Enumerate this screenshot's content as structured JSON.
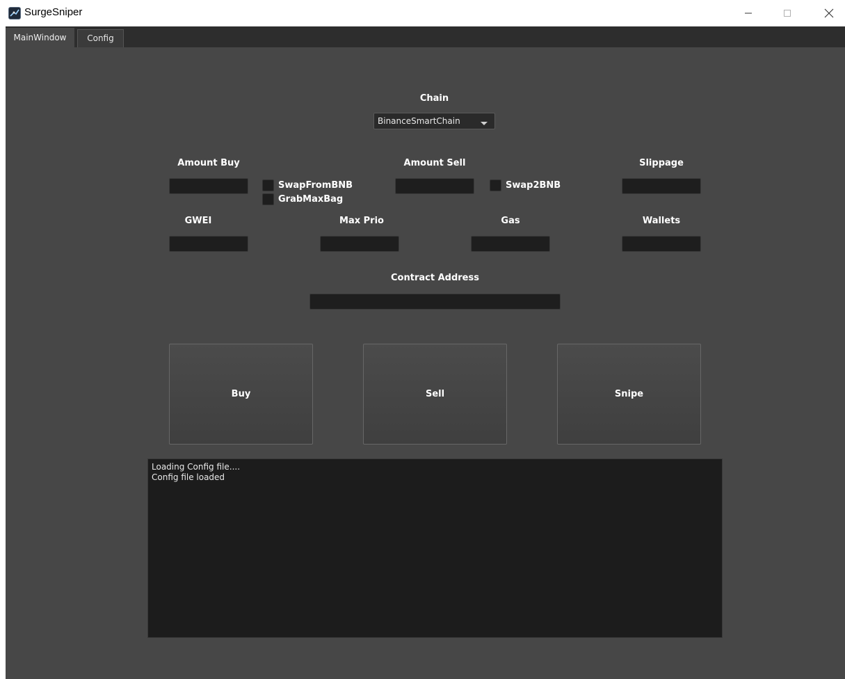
{
  "window": {
    "title": "SurgeSniper",
    "icon": "app-logo-icon",
    "controls": [
      "minimize-icon",
      "maximize-icon",
      "close-icon"
    ]
  },
  "tabs": [
    {
      "label": "MainWindow",
      "active": true
    },
    {
      "label": "Config",
      "active": false
    }
  ],
  "chain": {
    "label": "Chain",
    "selected": "BinanceSmartChain"
  },
  "amount_buy": {
    "label": "Amount Buy",
    "value": ""
  },
  "amount_sell": {
    "label": "Amount Sell",
    "value": ""
  },
  "slippage": {
    "label": "Slippage",
    "value": ""
  },
  "checkboxes": {
    "swap_from_bnb": {
      "label": "SwapFromBNB",
      "checked": false
    },
    "grab_max_bag": {
      "label": "GrabMaxBag",
      "checked": false
    },
    "swap2bnb": {
      "label": "Swap2BNB",
      "checked": false
    }
  },
  "gwei": {
    "label": "GWEI",
    "value": ""
  },
  "max_prio": {
    "label": "Max Prio",
    "value": ""
  },
  "gas": {
    "label": "Gas",
    "value": ""
  },
  "wallets": {
    "label": "Wallets",
    "value": ""
  },
  "contract_address": {
    "label": "Contract Address",
    "value": ""
  },
  "buttons": {
    "buy": "Buy",
    "sell": "Sell",
    "snipe": "Snipe"
  },
  "log": {
    "lines": [
      "Loading Config file....",
      "Config file loaded"
    ]
  },
  "colors": {
    "panel_bg": "#474747",
    "field_bg": "#1e1e1e",
    "log_bg": "#1c1c1c",
    "text": "#ffffff"
  }
}
